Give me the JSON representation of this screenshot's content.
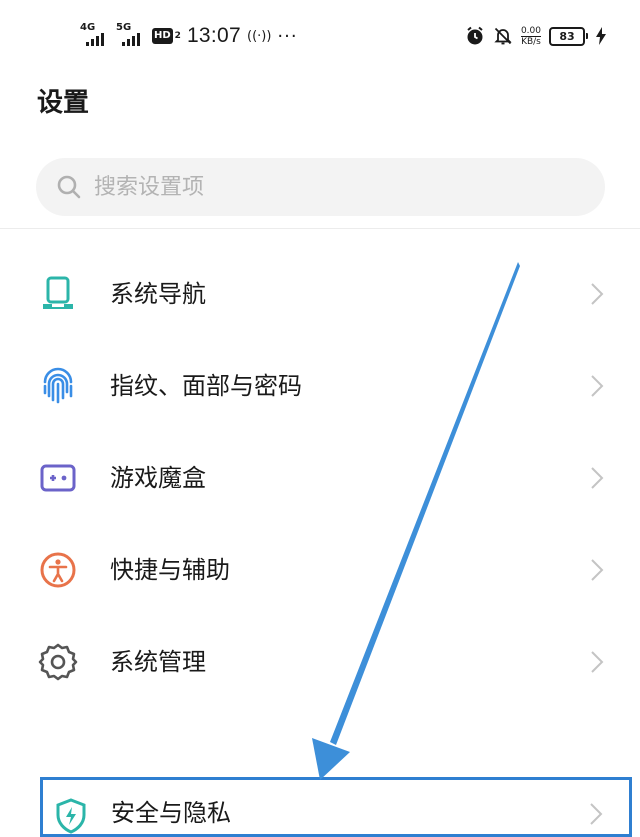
{
  "status_bar": {
    "network_1": "4G",
    "network_2": "5G",
    "hd": "HD",
    "hd_sub": "2",
    "time": "13:07",
    "extra": "((·))",
    "more": "···",
    "speed_value": "0.00",
    "speed_unit": "KB/s",
    "battery": "83",
    "icons": [
      "alarm-icon",
      "mute-bell-icon",
      "charging-bolt-icon"
    ]
  },
  "page": {
    "title": "设置"
  },
  "search": {
    "placeholder": "搜索设置项"
  },
  "menu": [
    {
      "label": "系统导航",
      "icon": "system-navigation-icon",
      "color": "#2bb5a9"
    },
    {
      "label": "指纹、面部与密码",
      "icon": "fingerprint-icon",
      "color": "#3a8ee6"
    },
    {
      "label": "游戏魔盒",
      "icon": "gamepad-icon",
      "color": "#6b63c9"
    },
    {
      "label": "快捷与辅助",
      "icon": "accessibility-icon",
      "color": "#e8734a"
    },
    {
      "label": "系统管理",
      "icon": "gear-icon",
      "color": "#555555"
    }
  ],
  "highlighted_item": {
    "label": "安全与隐私",
    "icon": "shield-icon",
    "color": "#2bb5a9"
  },
  "annotation": {
    "arrow_color": "#3d8fd9",
    "box_color": "#2f7fd1"
  }
}
